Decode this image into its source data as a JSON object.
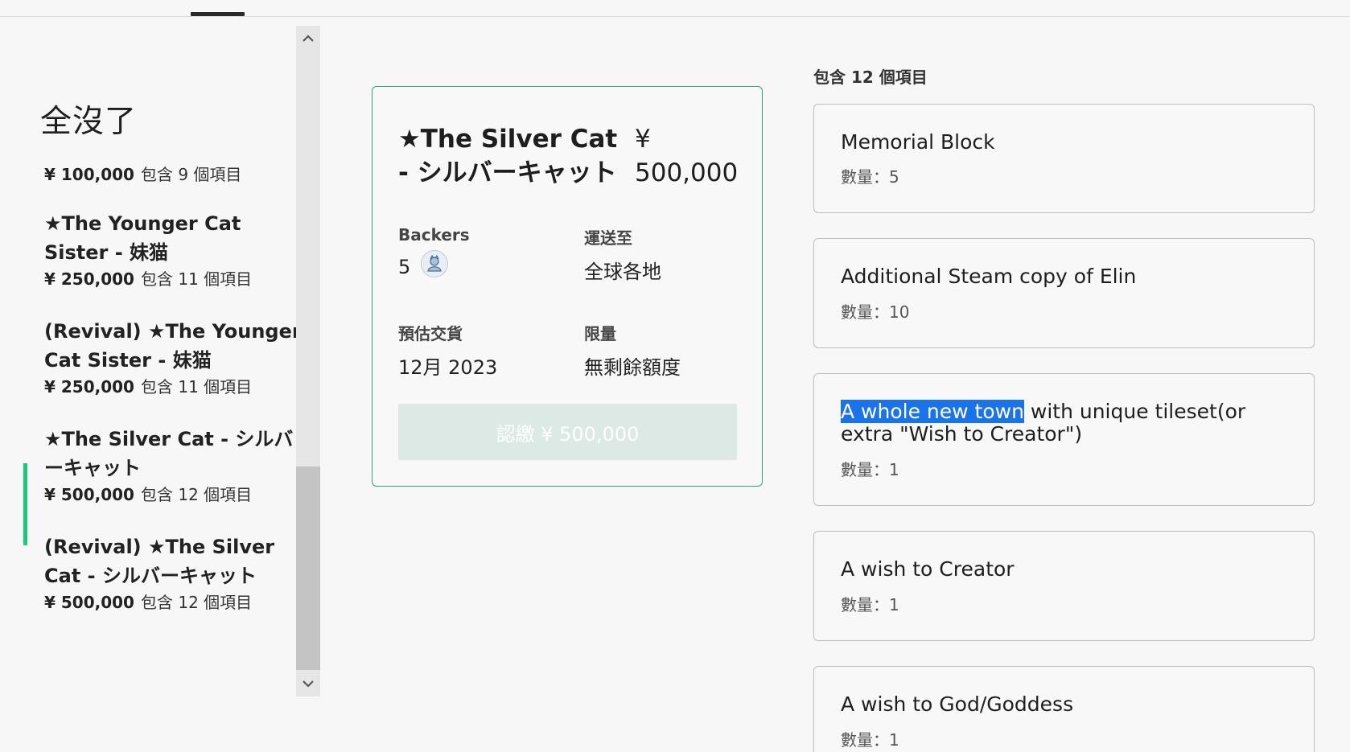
{
  "sidebar": {
    "title": "全沒了",
    "items": [
      {
        "name": "",
        "price": "¥ 100,000",
        "count": "包含 9 個項目"
      },
      {
        "name": "★The Younger Cat Sister - 妹猫",
        "price": "¥ 250,000",
        "count": "包含 11 個項目"
      },
      {
        "name": "(Revival) ★The Younger Cat Sister - 妹猫",
        "price": "¥ 250,000",
        "count": "包含 11 個項目"
      },
      {
        "name": "★The Silver Cat - シルバーキャット",
        "price": "¥ 500,000",
        "count": "包含 12 個項目"
      },
      {
        "name": "(Revival) ★The Silver Cat - シルバーキャット",
        "price": "¥ 500,000",
        "count": "包含 12 個項目"
      }
    ],
    "active_index": 3,
    "scroll_up_icon": "chevron-up",
    "scroll_down_icon": "chevron-down"
  },
  "reward": {
    "title": "★The Silver Cat - シルバーキャット",
    "price": "¥ 500,000",
    "backers_label": "Backers",
    "backers_value": "5",
    "ships_to_label": "運送至",
    "ships_to_value": "全球各地",
    "delivery_label": "預估交貨",
    "delivery_value": "12月 2023",
    "limit_label": "限量",
    "limit_value": "無剩餘額度",
    "pledge_button": "認繳 ¥ 500,000"
  },
  "included": {
    "heading": "包含 12 個項目",
    "items": [
      {
        "name": "Memorial Block",
        "qty": "數量：5"
      },
      {
        "name": "Additional Steam copy of Elin",
        "qty": "數量：10"
      },
      {
        "name_highlighted": "A whole new town",
        "name_rest": " with unique tileset(or extra \"Wish to Creator\")",
        "qty": "數量：1"
      },
      {
        "name": "A wish to Creator",
        "qty": "數量：1"
      },
      {
        "name": "A wish to God/Goddess",
        "qty": "數量：1"
      }
    ]
  },
  "colors": {
    "accent_green": "#1fc77b",
    "card_border": "#2fa37a",
    "selection": "#1a73e8"
  }
}
